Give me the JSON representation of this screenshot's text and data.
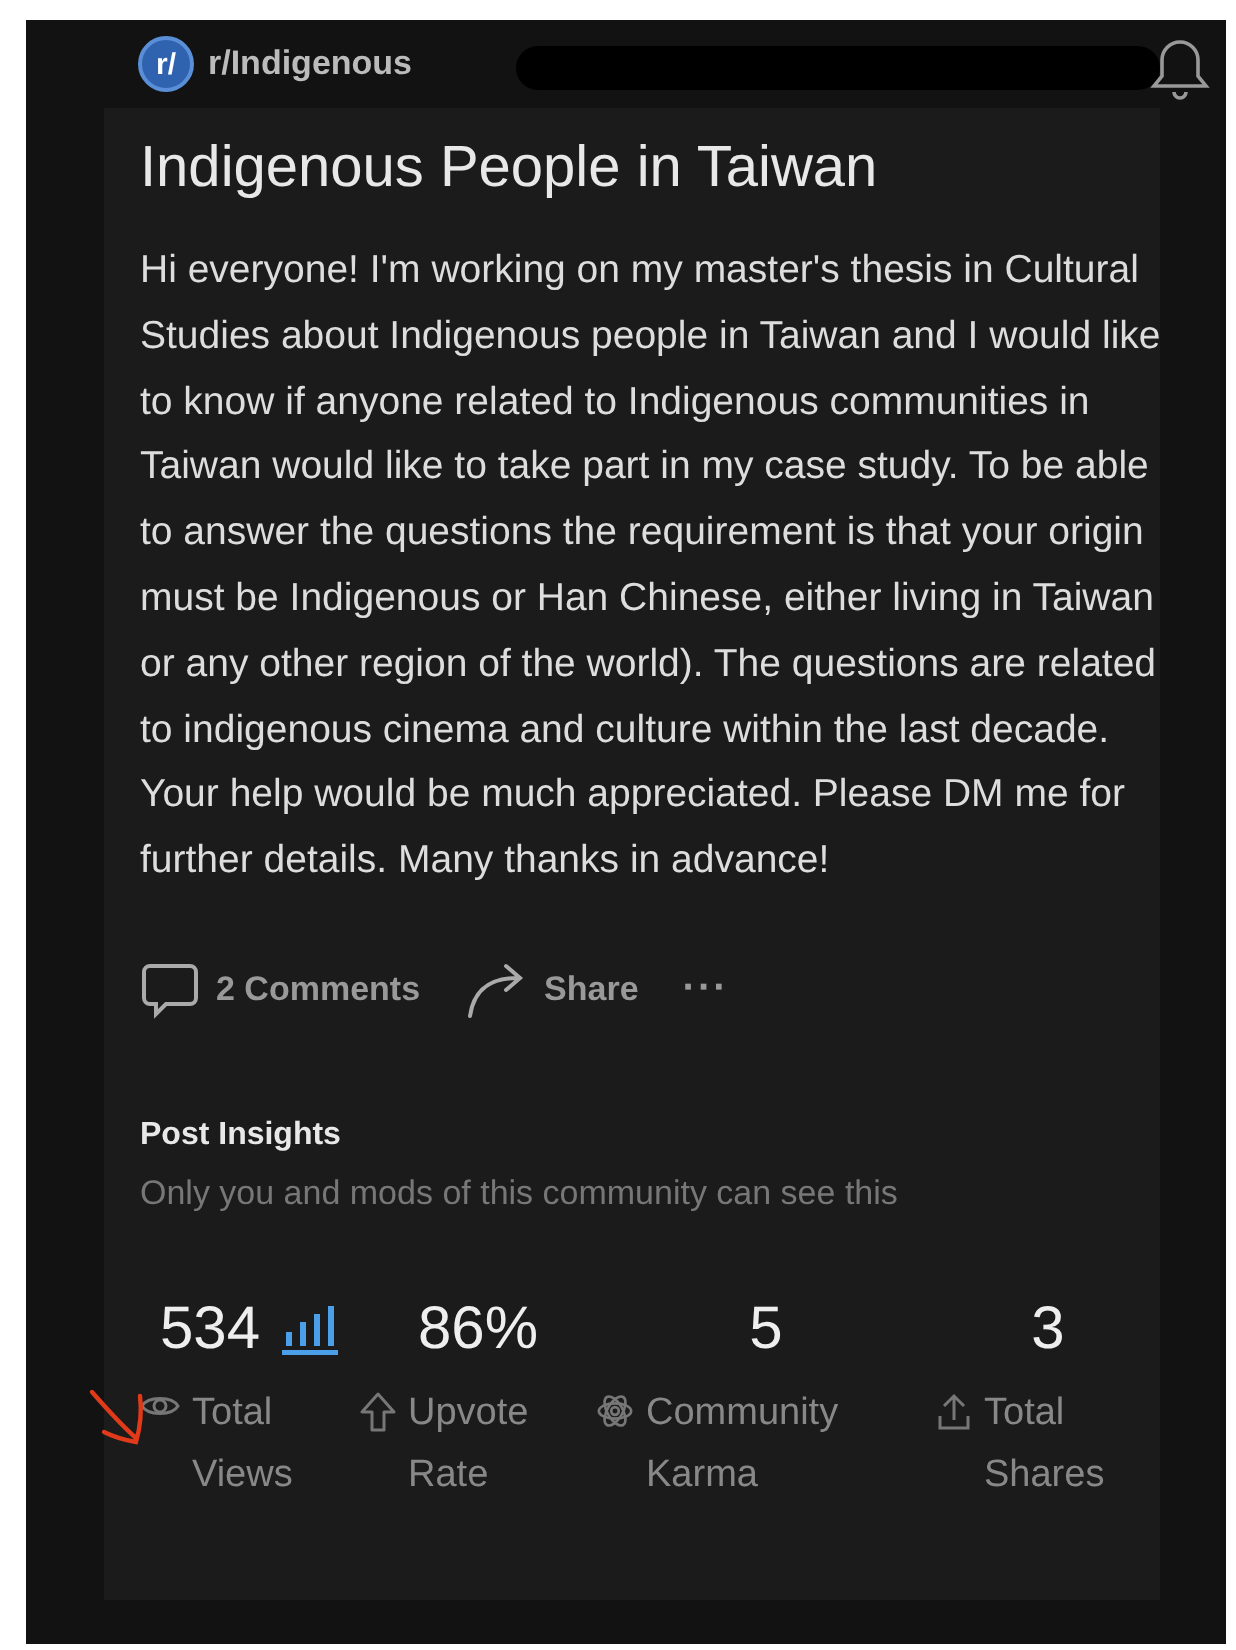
{
  "header": {
    "community": "r/Indigenous",
    "avatar": "r/"
  },
  "post": {
    "title": "Indigenous People in Taiwan",
    "body": "Hi everyone! I'm working on my master's thesis in Cultural Studies about Indigenous people in Taiwan and I would like to know if anyone related to Indigenous communities in Taiwan would like to take part in my case study. To be able to answer the questions the requirement is that your origin must be Indigenous or Han Chinese, either living in Taiwan or any other region of the world). The questions are related to indigenous cinema and culture within the last decade. Your help would be much appreciated. Please DM me for further details. Many thanks in advance!"
  },
  "actions": [
    {
      "kind": "comments",
      "label": "2 Comments"
    },
    {
      "kind": "share",
      "label": "Share"
    },
    {
      "kind": "more",
      "label": "···"
    }
  ],
  "insights": {
    "title": "Post Insights",
    "subtitle": "Only you and mods of this community can see this",
    "stats": [
      {
        "kind": "views",
        "value": "534",
        "label": "Total Views"
      },
      {
        "kind": "upvote",
        "value": "86%",
        "label": "Upvote Rate"
      },
      {
        "kind": "karma",
        "value": "5",
        "label": "Community Karma"
      },
      {
        "kind": "shares",
        "value": "3",
        "label": "Total Shares"
      }
    ]
  }
}
